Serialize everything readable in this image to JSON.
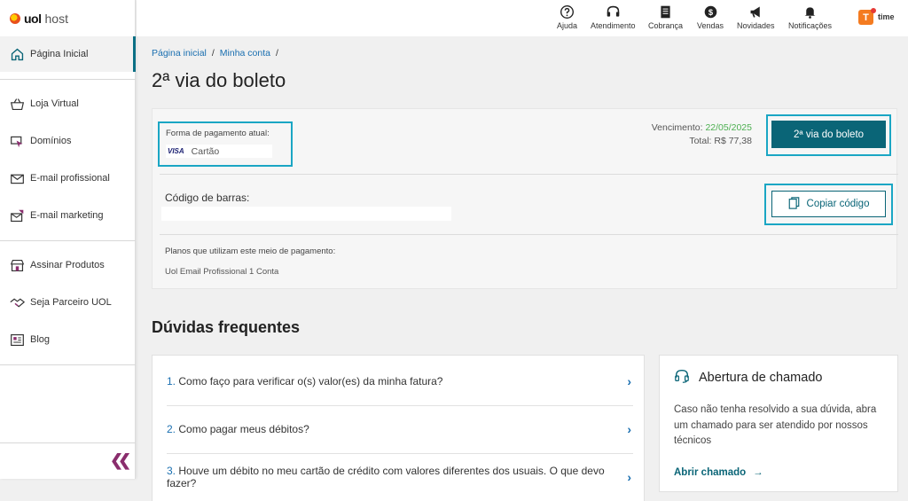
{
  "brand": {
    "mark": "uol",
    "name": "host"
  },
  "sidebar": {
    "items": [
      {
        "label": "Página Inicial",
        "icon": "home-icon"
      },
      {
        "label": "Loja Virtual",
        "icon": "basket-icon"
      },
      {
        "label": "Domínios",
        "icon": "domain-pointer-icon"
      },
      {
        "label": "E-mail profissional",
        "icon": "envelope-icon"
      },
      {
        "label": "E-mail marketing",
        "icon": "email-marketing-icon"
      },
      {
        "label": "Assinar Produtos",
        "icon": "store-icon"
      },
      {
        "label": "Seja Parceiro UOL",
        "icon": "handshake-icon"
      },
      {
        "label": "Blog",
        "icon": "blog-icon"
      }
    ],
    "collapse_icon": "double-chevron-left-icon"
  },
  "topbar": {
    "items": [
      {
        "label": "Ajuda",
        "icon": "question-icon"
      },
      {
        "label": "Atendimento",
        "icon": "headset-icon"
      },
      {
        "label": "Cobrança",
        "icon": "document-icon"
      },
      {
        "label": "Vendas",
        "icon": "dollar-icon"
      },
      {
        "label": "Novidades",
        "icon": "megaphone-icon"
      },
      {
        "label": "Notificações",
        "icon": "bell-icon"
      }
    ],
    "avatar_letter": "T",
    "team_label": "time"
  },
  "breadcrumb": {
    "items": [
      "Página inicial",
      "Minha conta"
    ],
    "separator": "/"
  },
  "page": {
    "title": "2ª via do boleto"
  },
  "payment": {
    "current_label": "Forma de pagamento atual:",
    "card_brand": "VISA",
    "method": "Cartão",
    "due_label": "Vencimento:",
    "due_date": "22/05/2025",
    "total_label": "Total:",
    "total_value": "R$ 77,38",
    "boleto_button": "2ª via do boleto",
    "barcode_label": "Código de barras:",
    "copy_button": "Copiar código",
    "plans_label": "Planos que utilizam este meio de pagamento:",
    "plan_value": "Uol Email Profissional 1 Conta"
  },
  "faq": {
    "title": "Dúvidas frequentes",
    "items": [
      {
        "num": "1.",
        "text": "Como faço para verificar o(s) valor(es) da minha fatura?"
      },
      {
        "num": "2.",
        "text": "Como pagar meus débitos?"
      },
      {
        "num": "3.",
        "text": "Houve um débito no meu cartão de crédito com valores diferentes dos usuais. O que devo fazer?"
      }
    ]
  },
  "support": {
    "title": "Abertura de chamado",
    "text": "Caso não tenha resolvido a sua dúvida, abra um chamado para ser atendido por nossos técnicos",
    "link": "Abrir chamado"
  },
  "colors": {
    "accent": "#0a6577",
    "highlight": "#1aa6c4",
    "link": "#1a6fb0",
    "due": "#4caf50"
  }
}
